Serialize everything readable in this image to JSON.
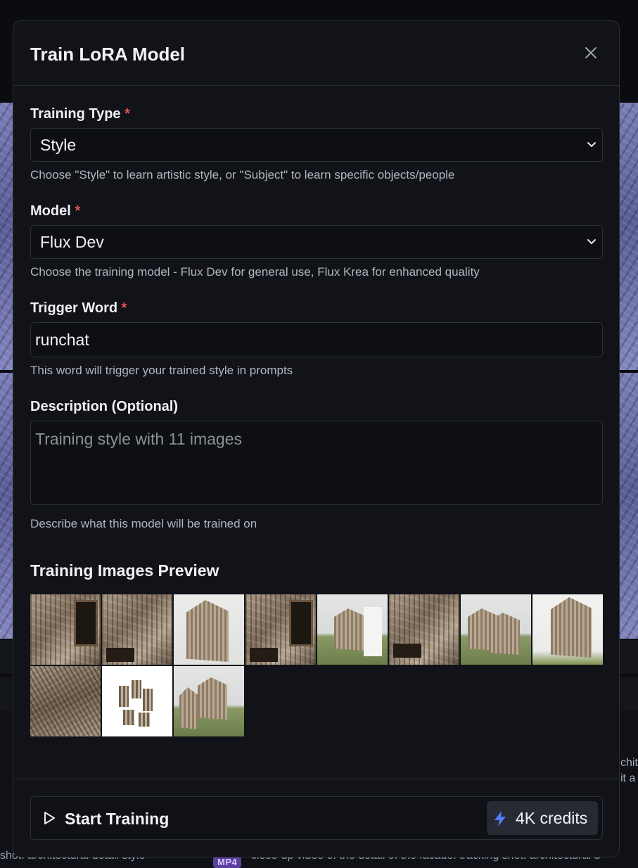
{
  "modal": {
    "title": "Train LoRA Model",
    "close_icon": "close-icon"
  },
  "training_type": {
    "label": "Training Type",
    "required_mark": "*",
    "value": "Style",
    "hint": "Choose \"Style\" to learn artistic style, or \"Subject\" to learn specific objects/people"
  },
  "model": {
    "label": "Model",
    "required_mark": "*",
    "value": "Flux Dev",
    "hint": "Choose the training model - Flux Dev for general use, Flux Krea for enhanced quality"
  },
  "trigger_word": {
    "label": "Trigger Word",
    "required_mark": "*",
    "value": "runchat",
    "hint": "This word will trigger your trained style in prompts"
  },
  "description": {
    "label": "Description (Optional)",
    "placeholder": "Training style with 11 images",
    "hint": "Describe what this model will be trained on"
  },
  "preview": {
    "title": "Training Images Preview",
    "image_count": 11
  },
  "footer": {
    "start_label": "Start Training",
    "start_icon": "play-icon",
    "credits_icon": "lightning-icon",
    "credits_label": "4K credits",
    "credits_icon_color": "#4f7cff"
  },
  "background": {
    "right_text_lines": [
      "chit",
      "it a"
    ],
    "bottom_left_text": "shot. architectural detail style",
    "bottom_right_text": "close-up video of the detail of the facade. tracking shot. architectural d",
    "badge": "MP4"
  }
}
